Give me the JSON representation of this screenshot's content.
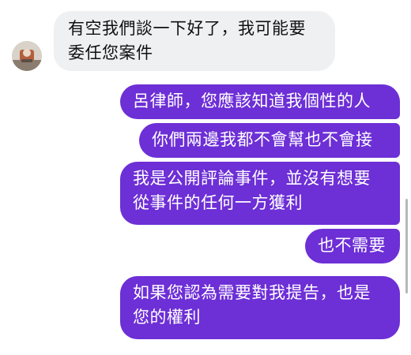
{
  "colors": {
    "outgoing_bubble": "#6d2fd6",
    "incoming_bubble": "#eff0f2",
    "outgoing_text": "#ffffff",
    "incoming_text": "#111111"
  },
  "incoming": {
    "lines": [
      "有空我們談一下好了，我可能要",
      "委任您案件"
    ]
  },
  "outgoing": [
    {
      "lines": [
        "呂律師，您應該知道我個性的人"
      ]
    },
    {
      "lines": [
        "你們兩邊我都不會幫也不會接"
      ]
    },
    {
      "lines": [
        "我是公開評論事件，並沒有想要",
        "從事件的任何一方獲利"
      ]
    },
    {
      "lines": [
        "也不需要"
      ]
    },
    {
      "lines": [
        "如果您認為需要對我提告，也是",
        "您的權利"
      ]
    }
  ]
}
